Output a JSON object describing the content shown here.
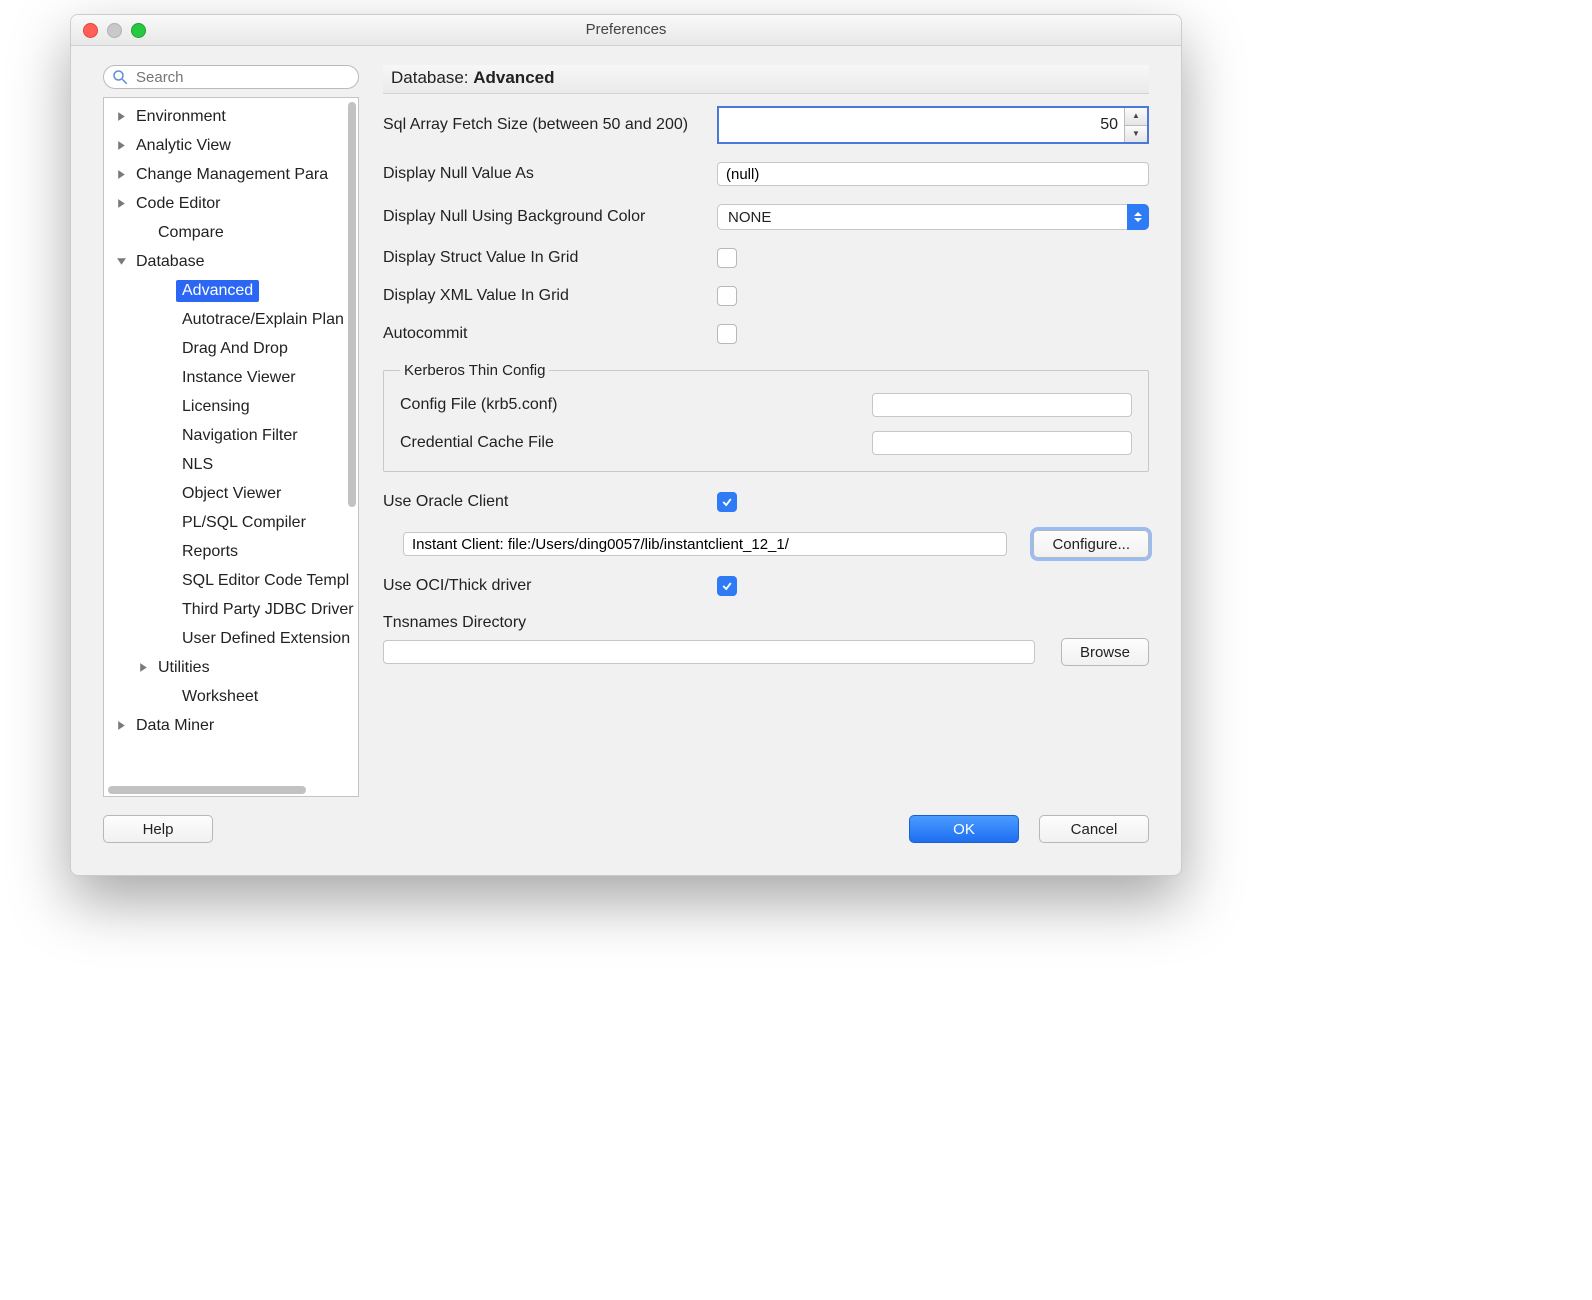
{
  "window": {
    "title": "Preferences"
  },
  "search": {
    "placeholder": "Search"
  },
  "sidebar": {
    "items": [
      {
        "label": "Environment",
        "depth": 0,
        "arrow": "right"
      },
      {
        "label": "Analytic View",
        "depth": 0,
        "arrow": "right"
      },
      {
        "label": "Change Management Para",
        "depth": 0,
        "arrow": "right"
      },
      {
        "label": "Code Editor",
        "depth": 0,
        "arrow": "right"
      },
      {
        "label": "Compare",
        "depth": 1,
        "arrow": "none"
      },
      {
        "label": "Database",
        "depth": 0,
        "arrow": "down"
      },
      {
        "label": "Advanced",
        "depth": 2,
        "arrow": "none",
        "selected": true
      },
      {
        "label": "Autotrace/Explain Plan",
        "depth": 2,
        "arrow": "none"
      },
      {
        "label": "Drag And Drop",
        "depth": 2,
        "arrow": "none"
      },
      {
        "label": "Instance Viewer",
        "depth": 2,
        "arrow": "none"
      },
      {
        "label": "Licensing",
        "depth": 2,
        "arrow": "none"
      },
      {
        "label": "Navigation Filter",
        "depth": 2,
        "arrow": "none"
      },
      {
        "label": "NLS",
        "depth": 2,
        "arrow": "none"
      },
      {
        "label": "Object Viewer",
        "depth": 2,
        "arrow": "none"
      },
      {
        "label": "PL/SQL Compiler",
        "depth": 2,
        "arrow": "none"
      },
      {
        "label": "Reports",
        "depth": 2,
        "arrow": "none"
      },
      {
        "label": "SQL Editor Code Templ",
        "depth": 2,
        "arrow": "none"
      },
      {
        "label": "Third Party JDBC Driver",
        "depth": 2,
        "arrow": "none"
      },
      {
        "label": "User Defined Extension",
        "depth": 2,
        "arrow": "none"
      },
      {
        "label": "Utilities",
        "depth": 1,
        "arrow": "right"
      },
      {
        "label": "Worksheet",
        "depth": 2,
        "arrow": "none"
      },
      {
        "label": "Data Miner",
        "depth": 0,
        "arrow": "right"
      }
    ]
  },
  "header": {
    "prefix": "Database: ",
    "bold": "Advanced"
  },
  "form": {
    "fetch_label": "Sql Array Fetch Size (between 50 and 200)",
    "fetch_value": "50",
    "null_as_label": "Display Null Value As",
    "null_as_value": "(null)",
    "null_bg_label": "Display Null Using Background Color",
    "null_bg_value": "NONE",
    "struct_label": "Display Struct Value In Grid",
    "xml_label": "Display XML Value In Grid",
    "autocommit_label": "Autocommit",
    "kerberos_legend": "Kerberos Thin Config",
    "kerb_config_label": "Config File (krb5.conf)",
    "kerb_cred_label": "Credential Cache File",
    "use_oracle_label": "Use Oracle Client",
    "instant_client_value": "Instant Client: file:/Users/ding0057/lib/instantclient_12_1/",
    "configure_label": "Configure...",
    "use_oci_label": "Use OCI/Thick driver",
    "tns_label": "Tnsnames Directory",
    "browse_label": "Browse"
  },
  "footer": {
    "help": "Help",
    "ok": "OK",
    "cancel": "Cancel"
  }
}
